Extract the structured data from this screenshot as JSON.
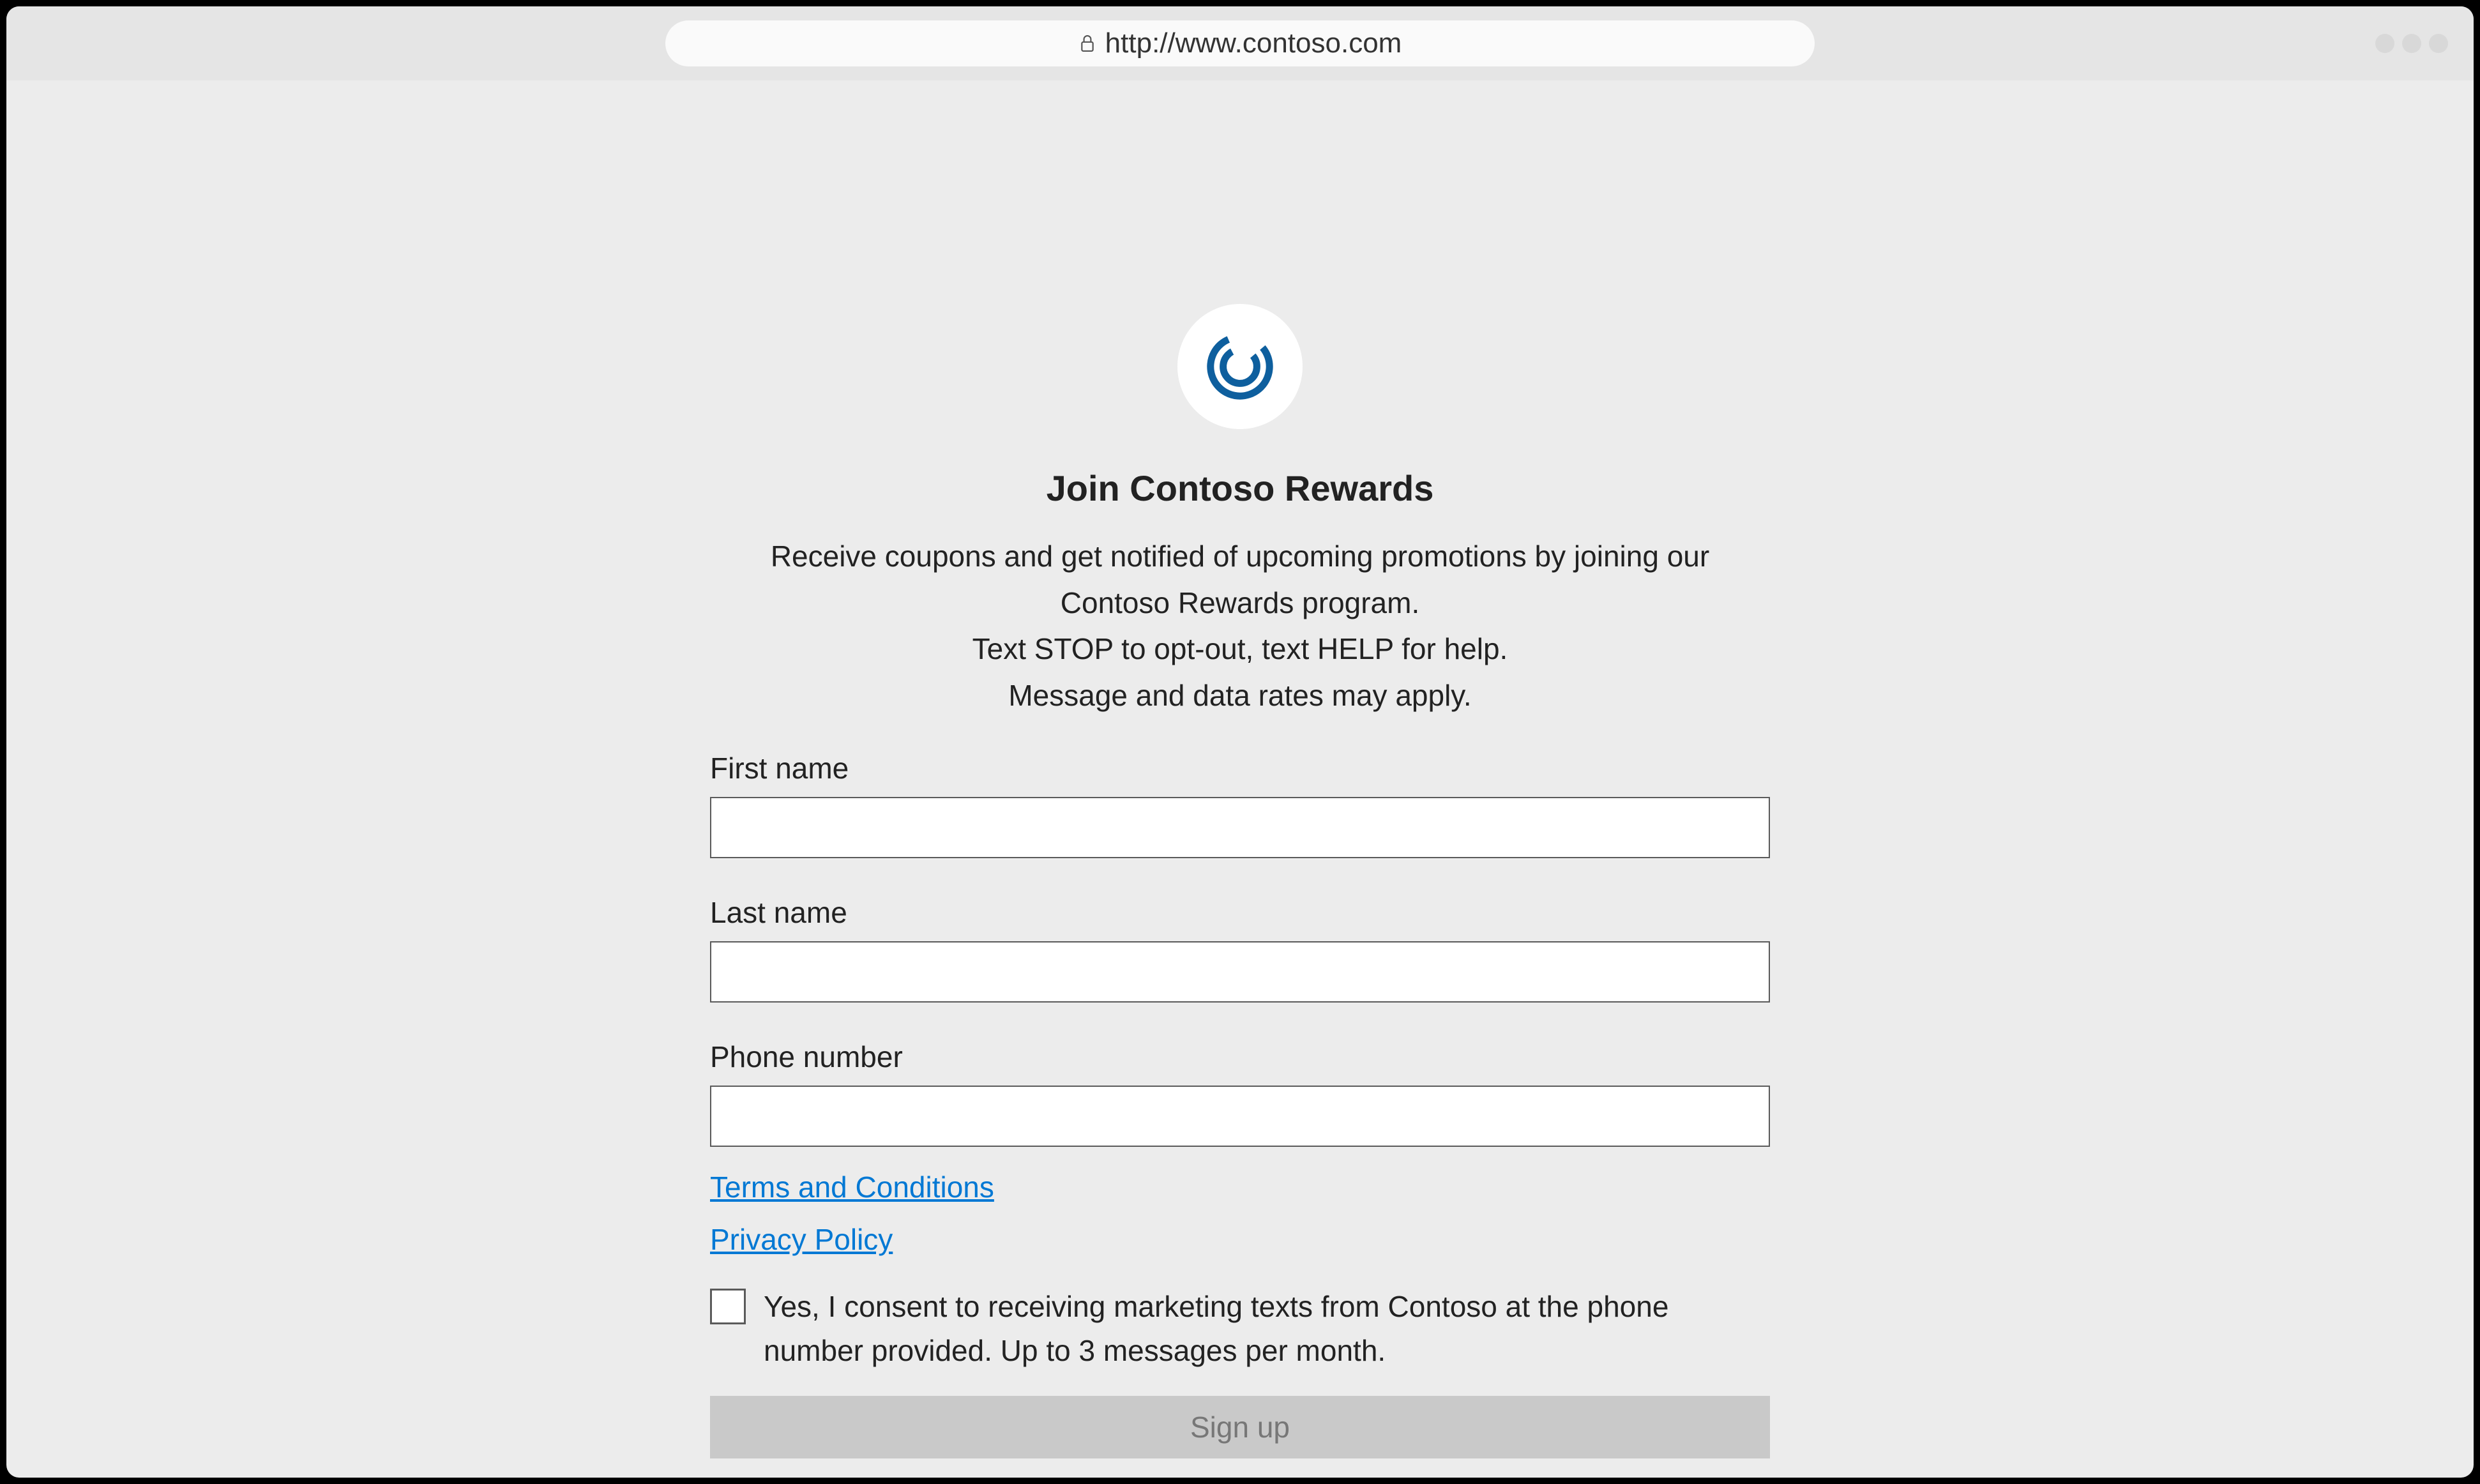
{
  "browser": {
    "url": "http://www.contoso.com"
  },
  "page": {
    "title": "Join Contoso Rewards",
    "description_line1": "Receive coupons and get notified of upcoming promotions by joining our Contoso Rewards program.",
    "description_line2": "Text STOP to opt-out, text HELP for help.",
    "description_line3": "Message and data rates may apply."
  },
  "form": {
    "first_name_label": "First name",
    "first_name_value": "",
    "last_name_label": "Last name",
    "last_name_value": "",
    "phone_label": "Phone number",
    "phone_value": "",
    "terms_link": "Terms and Conditions",
    "privacy_link": "Privacy Policy",
    "consent_text": "Yes, I consent to receiving marketing texts from Contoso at the phone number provided. Up to 3 messages per month.",
    "consent_checked": false,
    "submit_label": "Sign up"
  },
  "colors": {
    "link": "#0078d4",
    "logo": "#0e5f9e",
    "disabled_btn": "#c9c9c9"
  }
}
